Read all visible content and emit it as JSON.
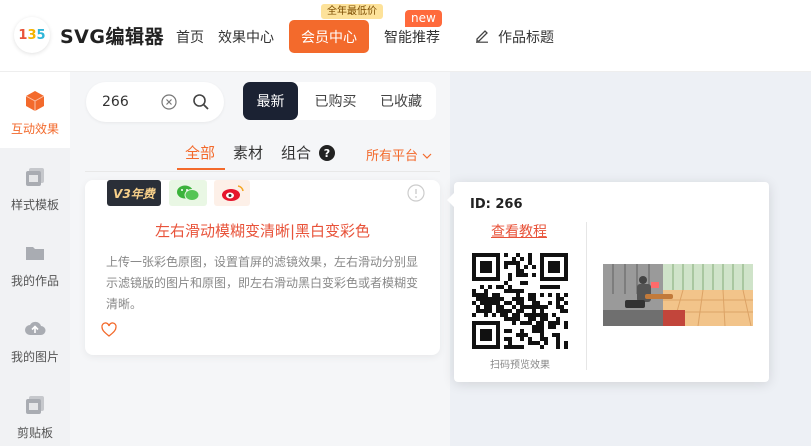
{
  "header": {
    "logo_text": [
      "1",
      "3",
      "5"
    ],
    "brand": "SVG编辑器",
    "nav": [
      "首页",
      "效果中心"
    ],
    "vip_label": "会员中心",
    "vip_tag": "全年最低价",
    "smart_label": "智能推荐",
    "new_tag": "new",
    "work_title": "作品标题"
  },
  "sidebar": {
    "items": [
      {
        "label": "互动效果",
        "icon": "cube-icon",
        "active": true
      },
      {
        "label": "样式模板",
        "icon": "template-icon"
      },
      {
        "label": "我的作品",
        "icon": "folder-icon"
      },
      {
        "label": "我的图片",
        "icon": "cloud-upload-icon"
      },
      {
        "label": "剪贴板",
        "icon": "clipboard-icon"
      }
    ]
  },
  "search": {
    "value": "266"
  },
  "segment": [
    "最新",
    "已购买",
    "已收藏"
  ],
  "tabs": [
    "全部",
    "素材",
    "组合"
  ],
  "help": "?",
  "platform": "所有平台",
  "card": {
    "badge": "V3年费",
    "title": "左右滑动模糊变清晰|黑白变彩色",
    "desc": "上传一张彩色原图，设置首屏的滤镜效果，左右滑动分别显示滤镜版的图片和原图，即左右滑动黑白变彩色或者模糊变清晰。"
  },
  "popup": {
    "id": "ID: 266",
    "tutorial": "查看教程",
    "qr_caption": "扫码预览效果"
  },
  "colors": {
    "accent": "#f36a2c",
    "dark": "#1b2233",
    "title_red": "#e8533a"
  }
}
